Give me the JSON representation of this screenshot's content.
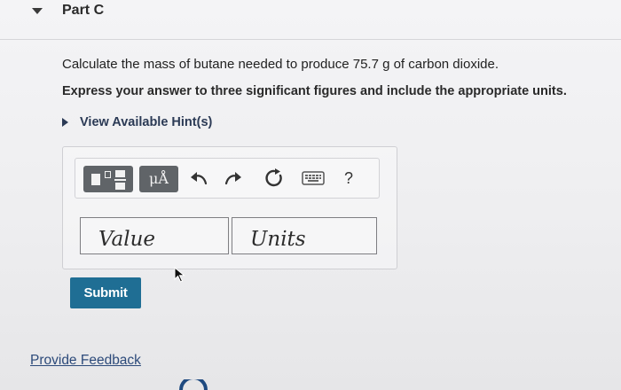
{
  "part": {
    "title": "Part C"
  },
  "question": {
    "text": "Calculate the mass of butane needed to produce 75.7 g of carbon dioxide.",
    "instruction": "Express your answer to three significant figures and include the appropriate units."
  },
  "hints": {
    "label": "View Available Hint(s)"
  },
  "toolbar": {
    "template_icon": "templates-icon",
    "units_label": "μÅ",
    "undo_icon": "undo-icon",
    "redo_icon": "redo-icon",
    "reset_icon": "reset-icon",
    "keyboard_icon": "keyboard-icon",
    "help_label": "?"
  },
  "answer": {
    "value_placeholder": "Value",
    "units_placeholder": "Units"
  },
  "actions": {
    "submit_label": "Submit",
    "feedback_label": "Provide Feedback"
  },
  "colors": {
    "submit_bg": "#1f6e94",
    "tool_bg": "#606468",
    "hint_text": "#2b3a55",
    "link": "#2c4a7a"
  }
}
